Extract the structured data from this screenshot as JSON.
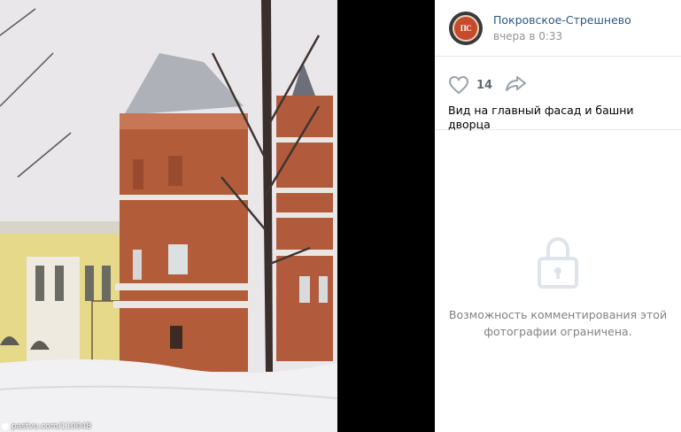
{
  "photo": {
    "alt": "Покровское-Стрешнево palace facade and towers",
    "watermark": "pastvu.com/110048"
  },
  "post": {
    "author": "Покровское-Стрешнево",
    "avatar_text": "ПС",
    "time": "вчера в 0:33",
    "likes": "14",
    "caption": "Вид на главный фасад и башни дворца"
  },
  "comments": {
    "closed_text": "Возможность комментирования этой фотографии ограничена."
  },
  "colors": {
    "link": "#2a5885",
    "muted": "#939393",
    "icon": "#99a2ad"
  }
}
